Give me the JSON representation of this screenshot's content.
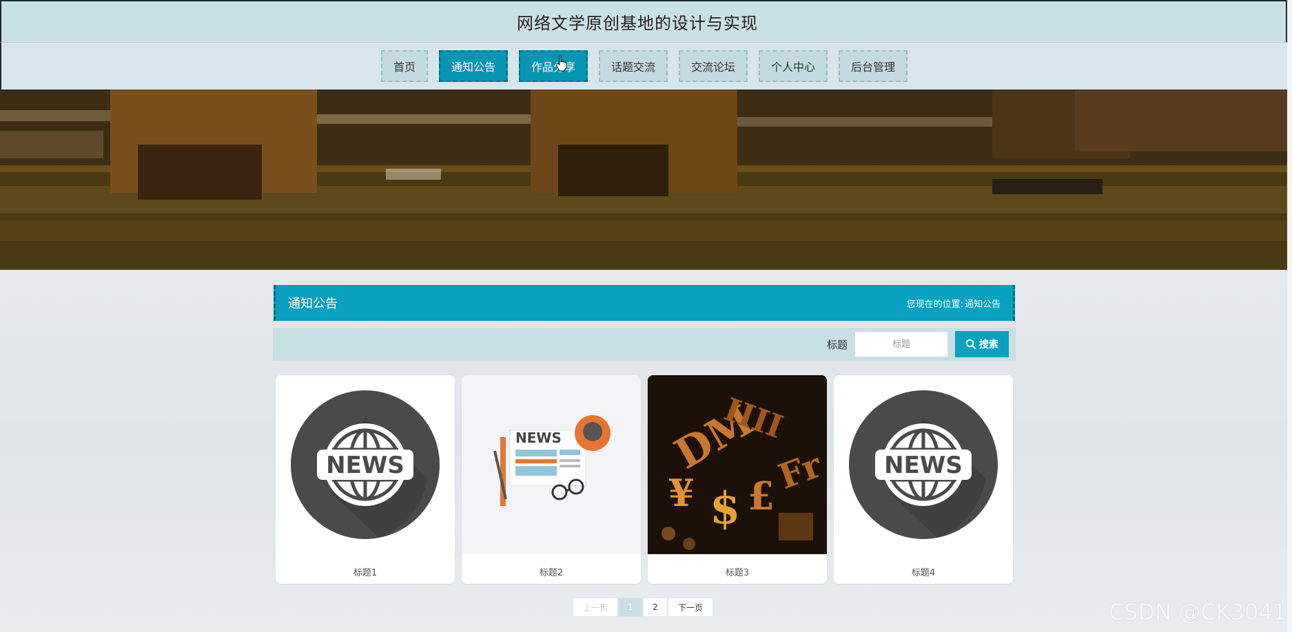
{
  "header": {
    "title": "网络文学原创基地的设计与实现"
  },
  "nav": {
    "items": [
      {
        "label": "首页",
        "active": false
      },
      {
        "label": "通知公告",
        "active": true
      },
      {
        "label": "作品分享",
        "active": true
      },
      {
        "label": "话题交流",
        "active": false
      },
      {
        "label": "交流论坛",
        "active": false
      },
      {
        "label": "个人中心",
        "active": false
      },
      {
        "label": "后台管理",
        "active": false
      }
    ]
  },
  "section": {
    "title": "通知公告",
    "breadcrumb_prefix": "您现在的位置:",
    "breadcrumb_current": "通知公告"
  },
  "search": {
    "label": "标题",
    "placeholder": "标题",
    "button_label": "搜索"
  },
  "cards": [
    {
      "title": "标题1",
      "image": "news-globe-icon"
    },
    {
      "title": "标题2",
      "image": "newspaper-illustration"
    },
    {
      "title": "标题3",
      "image": "currency-symbols-photo"
    },
    {
      "title": "标题4",
      "image": "news-globe-icon"
    }
  ],
  "pagination": {
    "prev_label": "上一页",
    "pages": [
      "1",
      "2"
    ],
    "current": "1",
    "next_label": "下一页"
  },
  "watermark": "CSDN @CK3041",
  "colors": {
    "accent": "#0aa0bf",
    "header_bg": "#c9e0e5",
    "nav_bg": "#d7e6ec"
  }
}
